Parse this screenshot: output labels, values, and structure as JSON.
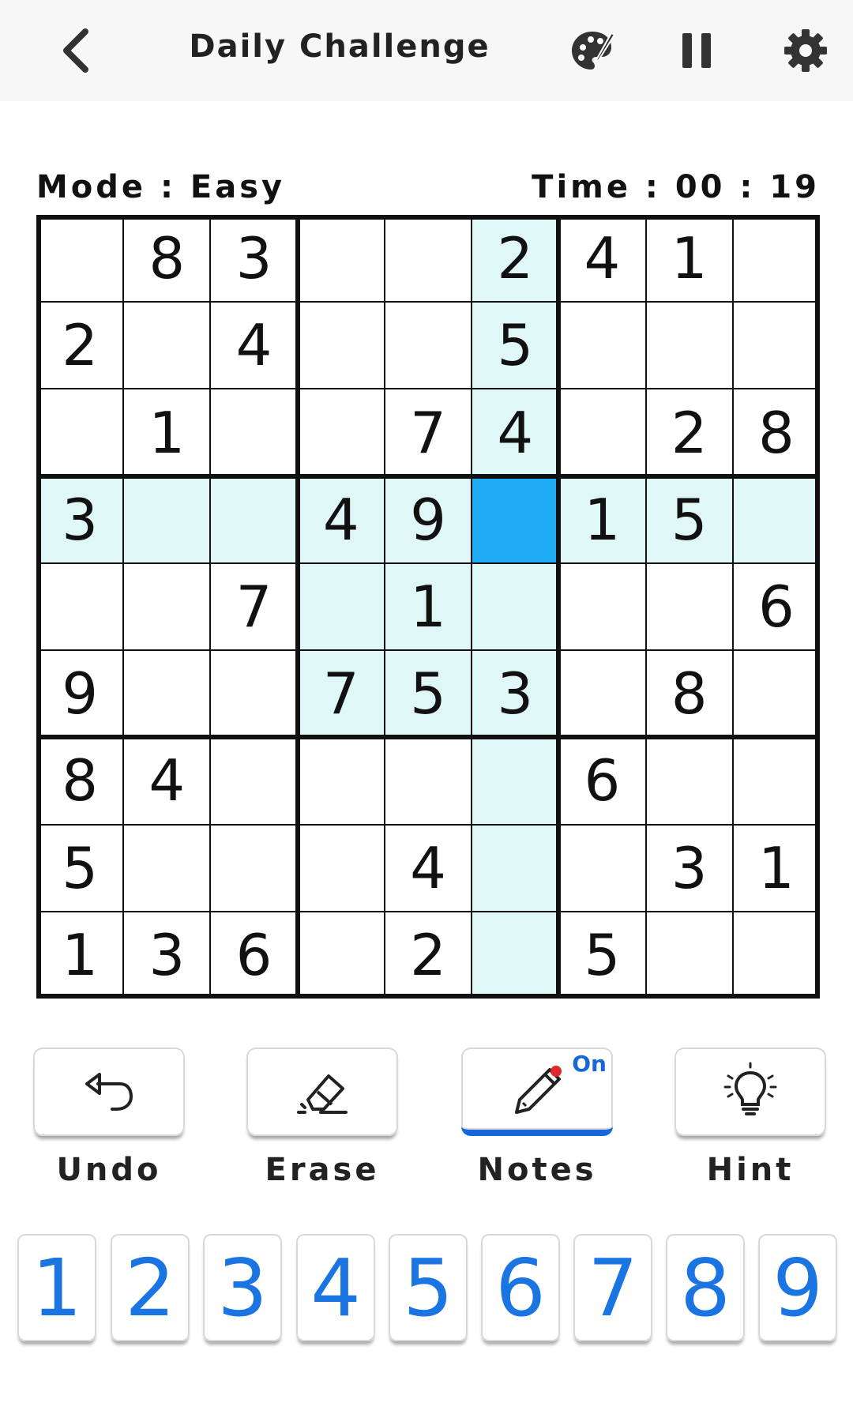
{
  "header": {
    "title": "Daily Challenge",
    "back_icon": "chevron-left-icon",
    "theme_icon": "palette-icon",
    "pause_icon": "pause-icon",
    "settings_icon": "gear-icon"
  },
  "status": {
    "mode": "Mode : Easy",
    "time": "Time : 00 : 19"
  },
  "board": {
    "selected": [
      3,
      5
    ],
    "highlight_color": "#e0f7f7",
    "selected_color": "#1eaaf5",
    "cells": [
      [
        "",
        "8",
        "3",
        "",
        "",
        "2",
        "4",
        "1",
        ""
      ],
      [
        "2",
        "",
        "4",
        "",
        "",
        "5",
        "",
        "",
        ""
      ],
      [
        "",
        "1",
        "",
        "",
        "7",
        "4",
        "",
        "2",
        "8"
      ],
      [
        "3",
        "",
        "",
        "4",
        "9",
        "",
        "1",
        "5",
        ""
      ],
      [
        "",
        "",
        "7",
        "",
        "1",
        "",
        "",
        "",
        "6"
      ],
      [
        "9",
        "",
        "",
        "7",
        "5",
        "3",
        "",
        "8",
        ""
      ],
      [
        "8",
        "4",
        "",
        "",
        "",
        "",
        "6",
        "",
        ""
      ],
      [
        "5",
        "",
        "",
        "",
        "4",
        "",
        "",
        "3",
        "1"
      ],
      [
        "1",
        "3",
        "6",
        "",
        "2",
        "",
        "5",
        "",
        ""
      ]
    ]
  },
  "tools": {
    "undo": {
      "label": "Undo",
      "icon": "undo-icon"
    },
    "erase": {
      "label": "Erase",
      "icon": "eraser-icon"
    },
    "notes": {
      "label": "Notes",
      "icon": "pencil-icon",
      "badge": "On"
    },
    "hint": {
      "label": "Hint",
      "icon": "lightbulb-icon"
    }
  },
  "numpad": [
    "1",
    "2",
    "3",
    "4",
    "5",
    "6",
    "7",
    "8",
    "9"
  ],
  "colors": {
    "accent": "#1668d8",
    "numpad_text": "#1a74e2"
  }
}
